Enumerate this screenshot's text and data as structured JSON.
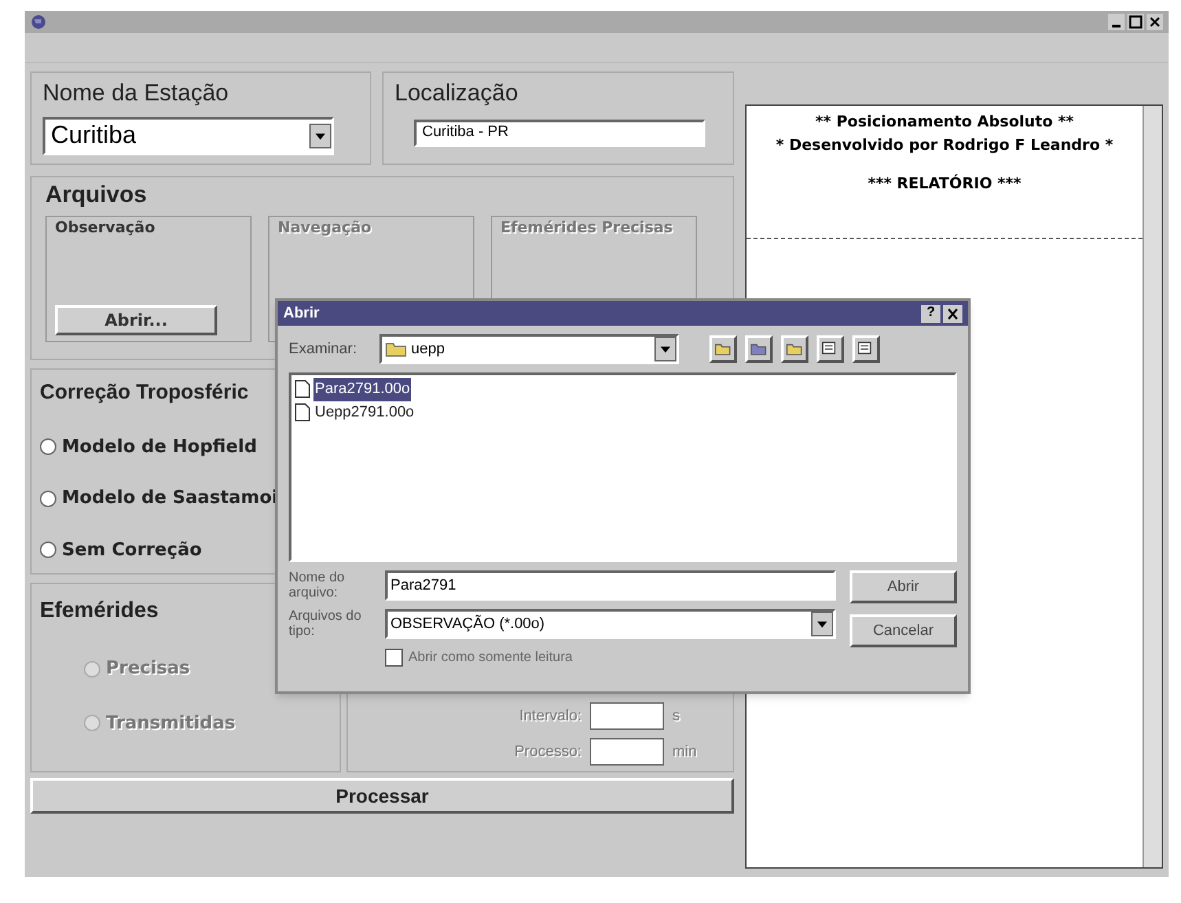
{
  "station": {
    "label": "Nome da Estação",
    "value": "Curitiba"
  },
  "location": {
    "label": "Localização",
    "value": "Curitiba - PR"
  },
  "files": {
    "title": "Arquivos",
    "groups": [
      {
        "label": "Observação",
        "disabled": false,
        "button": "Abrir..."
      },
      {
        "label": "Navegação",
        "disabled": true
      },
      {
        "label": "Efemérides Precisas",
        "disabled": true
      }
    ]
  },
  "troposphere": {
    "title": "Correção Troposféric",
    "options": [
      {
        "label": "Modelo de Hopfield",
        "selected": false
      },
      {
        "label": "Modelo de Saastamoi",
        "selected": false
      },
      {
        "label": "Sem Correção",
        "selected": false
      }
    ]
  },
  "ephemerides": {
    "title": "Efemérides",
    "options": [
      {
        "label": "Precisas",
        "selected": false,
        "disabled": true
      },
      {
        "label": "Transmitidas",
        "selected": false,
        "disabled": true
      }
    ]
  },
  "settings": [
    {
      "label": "Intervalo:",
      "unit": "s"
    },
    {
      "label": "Processo:",
      "unit": "min"
    }
  ],
  "process_button": "Processar",
  "report": {
    "lines": [
      "** Posicionamento Absoluto **",
      "* Desenvolvido por Rodrigo F Leandro *",
      "*** RELATÓRIO ***"
    ]
  },
  "dialog": {
    "title": "Abrir",
    "help": "?",
    "look_in_label": "Examinar:",
    "folder": "uepp",
    "files": [
      {
        "name": "Para2791.00o",
        "selected": true
      },
      {
        "name": "Uepp2791.00o",
        "selected": false
      }
    ],
    "filename_label": "Nome do arquivo:",
    "filename": "Para2791",
    "type_label": "Arquivos do tipo:",
    "type": "OBSERVAÇÃO (*.00o)",
    "readonly": {
      "label": "Abrir como somente leitura",
      "checked": false
    },
    "buttons": [
      "Abrir",
      "Cancelar"
    ]
  }
}
